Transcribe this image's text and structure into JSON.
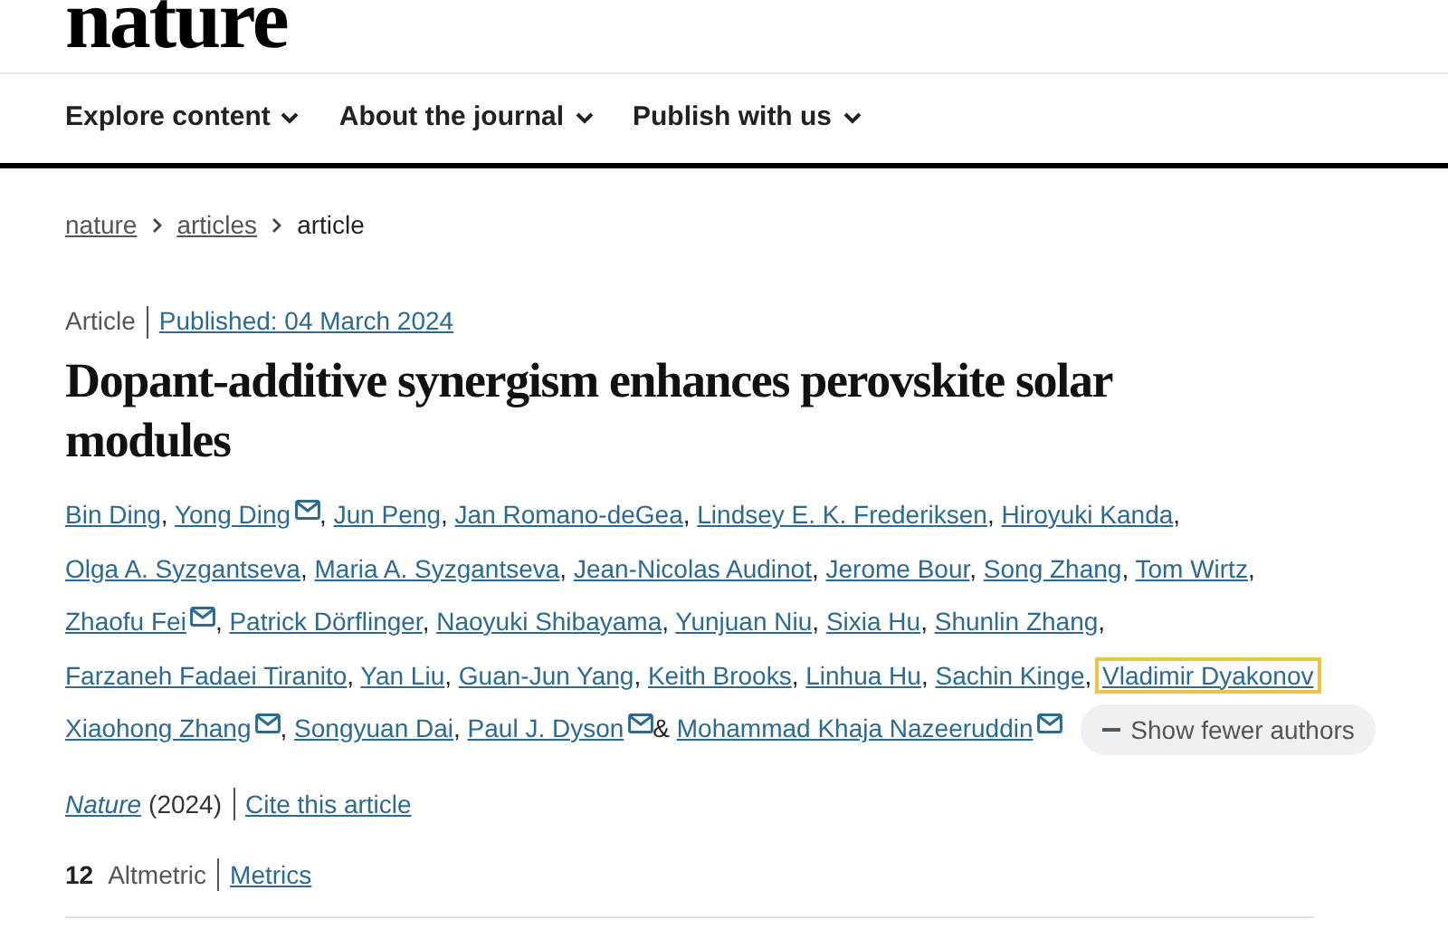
{
  "logo": "nature",
  "nav": [
    {
      "label": "Explore content"
    },
    {
      "label": "About the journal"
    },
    {
      "label": "Publish with us"
    }
  ],
  "breadcrumb": [
    {
      "label": "nature",
      "link": true
    },
    {
      "label": "articles",
      "link": true
    },
    {
      "label": "article",
      "link": false
    }
  ],
  "article_type": "Article",
  "published": "Published: 04 March 2024",
  "title": "Dopant-additive synergism enhances perovskite solar modules",
  "authors": [
    {
      "name": "Bin Ding",
      "email": false,
      "focused": false,
      "sep": ","
    },
    {
      "name": "Yong Ding",
      "email": true,
      "focused": false,
      "sep": ","
    },
    {
      "name": "Jun Peng",
      "email": false,
      "focused": false,
      "sep": ","
    },
    {
      "name": "Jan Romano-deGea",
      "email": false,
      "focused": false,
      "sep": ","
    },
    {
      "name": "Lindsey E. K. Frederiksen",
      "email": false,
      "focused": false,
      "sep": ","
    },
    {
      "name": "Hiroyuki Kanda",
      "email": false,
      "focused": false,
      "sep": ","
    },
    {
      "name": "Olga A. Syzgantseva",
      "email": false,
      "focused": false,
      "sep": ","
    },
    {
      "name": "Maria A. Syzgantseva",
      "email": false,
      "focused": false,
      "sep": ","
    },
    {
      "name": "Jean-Nicolas Audinot",
      "email": false,
      "focused": false,
      "sep": ","
    },
    {
      "name": "Jerome Bour",
      "email": false,
      "focused": false,
      "sep": ","
    },
    {
      "name": "Song Zhang",
      "email": false,
      "focused": false,
      "sep": ","
    },
    {
      "name": "Tom Wirtz",
      "email": false,
      "focused": false,
      "sep": ","
    },
    {
      "name": "Zhaofu Fei",
      "email": true,
      "focused": false,
      "sep": ","
    },
    {
      "name": "Patrick Dörflinger",
      "email": false,
      "focused": false,
      "sep": ","
    },
    {
      "name": "Naoyuki Shibayama",
      "email": false,
      "focused": false,
      "sep": ","
    },
    {
      "name": "Yunjuan Niu",
      "email": false,
      "focused": false,
      "sep": ","
    },
    {
      "name": "Sixia Hu",
      "email": false,
      "focused": false,
      "sep": ","
    },
    {
      "name": "Shunlin Zhang",
      "email": false,
      "focused": false,
      "sep": ","
    },
    {
      "name": "Farzaneh Fadaei Tiranito",
      "email": false,
      "focused": false,
      "sep": ","
    },
    {
      "name": "Yan Liu",
      "email": false,
      "focused": false,
      "sep": ","
    },
    {
      "name": "Guan-Jun Yang",
      "email": false,
      "focused": false,
      "sep": ","
    },
    {
      "name": "Keith Brooks",
      "email": false,
      "focused": false,
      "sep": ","
    },
    {
      "name": "Linhua Hu",
      "email": false,
      "focused": false,
      "sep": ","
    },
    {
      "name": "Sachin Kinge",
      "email": false,
      "focused": false,
      "sep": ","
    },
    {
      "name": "Vladimir Dyakonov",
      "email": false,
      "focused": true
    },
    {
      "name": "Xiaohong Zhang",
      "email": true,
      "focused": false,
      "sep": ","
    },
    {
      "name": "Songyuan Dai",
      "email": false,
      "focused": false,
      "sep": ","
    },
    {
      "name": "Paul J. Dyson",
      "email": true,
      "focused": false,
      "sep": "&"
    },
    {
      "name": "Mohammad Khaja Nazeeruddin",
      "email": true,
      "focused": false
    }
  ],
  "show_fewer": "Show fewer authors",
  "journal": "Nature",
  "year": "(2024)",
  "cite": "Cite this article",
  "altmetric_count": "12",
  "altmetric_label": "Altmetric",
  "metrics": "Metrics"
}
